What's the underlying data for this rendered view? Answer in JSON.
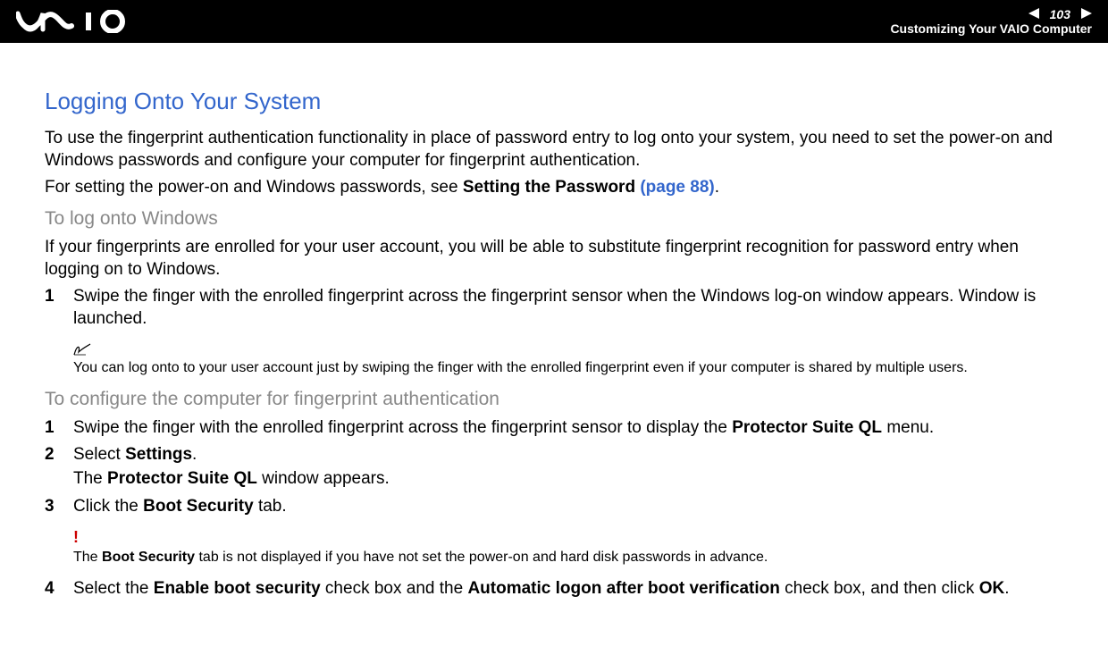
{
  "header": {
    "page_number": "103",
    "subtitle": "Customizing Your VAIO Computer"
  },
  "main": {
    "title": "Logging Onto Your System",
    "intro_para": "To use the fingerprint authentication functionality in place of password entry to log onto your system, you need to set the power-on and Windows passwords and configure your computer for fingerprint authentication.",
    "ref_prefix": "For setting the power-on and Windows passwords, see ",
    "ref_bold": "Setting the Password ",
    "ref_link": "(page 88)",
    "ref_suffix": ".",
    "sub1_heading": "To log onto Windows",
    "sub1_para": "If your fingerprints are enrolled for your user account, you will be able to substitute fingerprint recognition for password entry when logging on to Windows.",
    "step1_num": "1",
    "step1_text": "Swipe the finger with the enrolled fingerprint across the fingerprint sensor when the Windows log-on window appears. Window is launched.",
    "note1_text": "You can log onto to your user account just by swiping the finger with the enrolled fingerprint even if your computer is shared by multiple users.",
    "sub2_heading": "To configure the computer for fingerprint authentication",
    "cfg_step1_num": "1",
    "cfg_step1_prefix": "Swipe the finger with the enrolled fingerprint across the fingerprint sensor to display the ",
    "cfg_step1_bold": "Protector Suite QL",
    "cfg_step1_suffix": " menu.",
    "cfg_step2_num": "2",
    "cfg_step2_prefix": "Select ",
    "cfg_step2_bold": "Settings",
    "cfg_step2_suffix": ".",
    "cfg_step2_sub_prefix": "The ",
    "cfg_step2_sub_bold": "Protector Suite QL",
    "cfg_step2_sub_suffix": " window appears.",
    "cfg_step3_num": "3",
    "cfg_step3_prefix": " Click the ",
    "cfg_step3_bold": "Boot Security",
    "cfg_step3_suffix": " tab.",
    "warning_icon": "!",
    "warning_prefix": "The ",
    "warning_bold": "Boot Security",
    "warning_suffix": " tab is not displayed if you have not set the power-on and hard disk passwords in advance.",
    "cfg_step4_num": "4",
    "cfg_step4_prefix": "Select the ",
    "cfg_step4_bold1": "Enable boot security",
    "cfg_step4_mid1": " check box and the ",
    "cfg_step4_bold2": "Automatic logon after boot verification",
    "cfg_step4_mid2": " check box, and then click ",
    "cfg_step4_bold3": "OK",
    "cfg_step4_suffix": "."
  }
}
